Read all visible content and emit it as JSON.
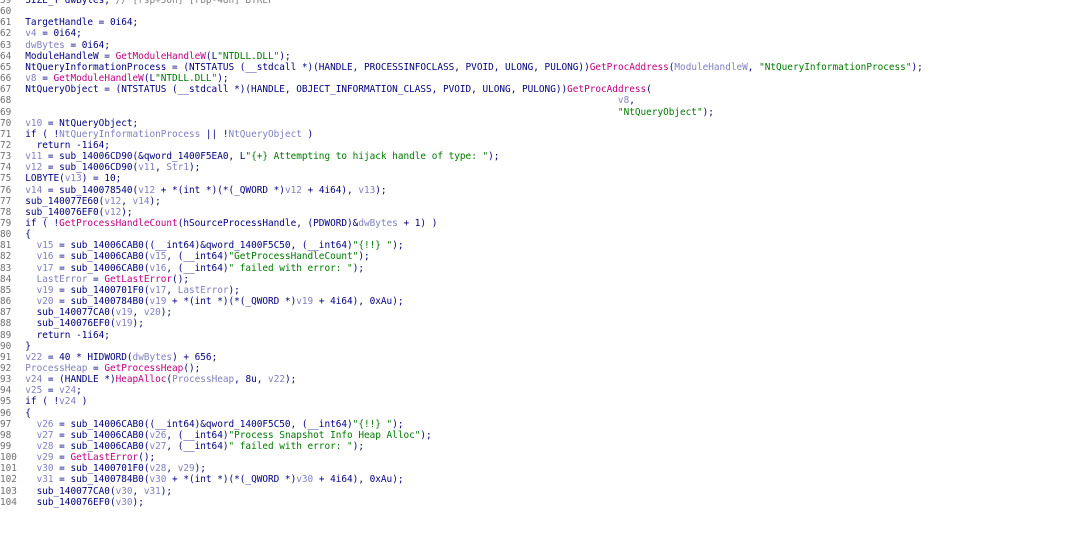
{
  "colors": {
    "background": "#ffffff",
    "default_text": "#000080",
    "function": "#c00080",
    "string": "#007a00",
    "comment": "#7f7f7f",
    "variable": "#8080c0",
    "line_number": "#707070"
  },
  "lines": [
    {
      "num": "59",
      "tokens": [
        [
          "k",
          "  SIZE_T dwBytes; "
        ],
        [
          "c",
          "// [rsp+50h] [rbp-48h] BYREF"
        ]
      ]
    },
    {
      "num": "60",
      "tokens": []
    },
    {
      "num": "61",
      "tokens": [
        [
          "k",
          "  TargetHandle = 0i64;"
        ]
      ]
    },
    {
      "num": "62",
      "tokens": [
        [
          "v",
          "  v4"
        ],
        [
          "k",
          " = 0i64;"
        ]
      ]
    },
    {
      "num": "63",
      "tokens": [
        [
          "v",
          "  dwBytes"
        ],
        [
          "k",
          " = 0i64;"
        ]
      ]
    },
    {
      "num": "64",
      "tokens": [
        [
          "k",
          "  ModuleHandleW = "
        ],
        [
          "f",
          "GetModuleHandleW"
        ],
        [
          "k",
          "(L"
        ],
        [
          "s",
          "\"NTDLL.DLL\""
        ],
        [
          "k",
          ");"
        ]
      ]
    },
    {
      "num": "65",
      "tokens": [
        [
          "k",
          "  NtQueryInformationProcess = (NTSTATUS (__stdcall *)(HANDLE, PROCESSINFOCLASS, PVOID, ULONG, PULONG))"
        ],
        [
          "f",
          "GetProcAddress"
        ],
        [
          "k",
          "("
        ],
        [
          "v",
          "ModuleHandleW"
        ],
        [
          "k",
          ", "
        ],
        [
          "s",
          "\"NtQueryInformationProcess\""
        ],
        [
          "k",
          ");"
        ]
      ]
    },
    {
      "num": "66",
      "tokens": [
        [
          "v",
          "  v8"
        ],
        [
          "k",
          " = "
        ],
        [
          "f",
          "GetModuleHandleW"
        ],
        [
          "k",
          "(L"
        ],
        [
          "s",
          "\"NTDLL.DLL\""
        ],
        [
          "k",
          ");"
        ]
      ]
    },
    {
      "num": "67",
      "tokens": [
        [
          "k",
          "  NtQueryObject = (NTSTATUS (__stdcall *)(HANDLE, OBJECT_INFORMATION_CLASS, PVOID, ULONG, PULONG))"
        ],
        [
          "f",
          "GetProcAddress"
        ],
        [
          "k",
          "("
        ]
      ]
    },
    {
      "num": "68",
      "tokens": [
        [
          "v",
          "                                                                                                           v8"
        ],
        [
          "k",
          ","
        ]
      ]
    },
    {
      "num": "69",
      "tokens": [
        [
          "s",
          "                                                                                                           \"NtQueryObject\""
        ],
        [
          "k",
          ");"
        ]
      ]
    },
    {
      "num": "70",
      "tokens": [
        [
          "v",
          "  v10"
        ],
        [
          "k",
          " = NtQueryObject;"
        ]
      ]
    },
    {
      "num": "71",
      "tokens": [
        [
          "k",
          "  if ( !"
        ],
        [
          "v",
          "NtQueryInformationProcess"
        ],
        [
          "k",
          " || !"
        ],
        [
          "v",
          "NtQueryObject"
        ],
        [
          "k",
          " )"
        ]
      ]
    },
    {
      "num": "72",
      "tokens": [
        [
          "k",
          "    return -1i64;"
        ]
      ]
    },
    {
      "num": "73",
      "tokens": [
        [
          "v",
          "  v11"
        ],
        [
          "k",
          " = sub_14006CD90(&qword_1400F5EA0, L"
        ],
        [
          "s",
          "\"{+} Attempting to hijack handle of type: \""
        ],
        [
          "k",
          ");"
        ]
      ]
    },
    {
      "num": "74",
      "tokens": [
        [
          "v",
          "  v12"
        ],
        [
          "k",
          " = sub_14006CD90("
        ],
        [
          "v",
          "v11"
        ],
        [
          "k",
          ", "
        ],
        [
          "v",
          "Str1"
        ],
        [
          "k",
          ");"
        ]
      ]
    },
    {
      "num": "75",
      "tokens": [
        [
          "k",
          "  LOBYTE("
        ],
        [
          "v",
          "v13"
        ],
        [
          "k",
          ") = 10;"
        ]
      ]
    },
    {
      "num": "76",
      "tokens": [
        [
          "v",
          "  v14"
        ],
        [
          "k",
          " = sub_140078540("
        ],
        [
          "v",
          "v12"
        ],
        [
          "k",
          " + *(int *)(*(_QWORD *)"
        ],
        [
          "v",
          "v12"
        ],
        [
          "k",
          " + 4i64), "
        ],
        [
          "v",
          "v13"
        ],
        [
          "k",
          ");"
        ]
      ]
    },
    {
      "num": "77",
      "tokens": [
        [
          "k",
          "  sub_140077E60("
        ],
        [
          "v",
          "v12"
        ],
        [
          "k",
          ", "
        ],
        [
          "v",
          "v14"
        ],
        [
          "k",
          ");"
        ]
      ]
    },
    {
      "num": "78",
      "tokens": [
        [
          "k",
          "  sub_140076EF0("
        ],
        [
          "v",
          "v12"
        ],
        [
          "k",
          ");"
        ]
      ]
    },
    {
      "num": "79",
      "tokens": [
        [
          "k",
          "  if ( !"
        ],
        [
          "f",
          "GetProcessHandleCount"
        ],
        [
          "k",
          "(hSourceProcessHandle, (PDWORD)&"
        ],
        [
          "v",
          "dwBytes"
        ],
        [
          "k",
          " + 1) )"
        ]
      ]
    },
    {
      "num": "80",
      "tokens": [
        [
          "k",
          "  {"
        ]
      ]
    },
    {
      "num": "81",
      "tokens": [
        [
          "v",
          "    v15"
        ],
        [
          "k",
          " = sub_14006CAB0((__int64)&qword_1400F5C50, (__int64)"
        ],
        [
          "s",
          "\"{!!} \""
        ],
        [
          "k",
          ");"
        ]
      ]
    },
    {
      "num": "82",
      "tokens": [
        [
          "v",
          "    v16"
        ],
        [
          "k",
          " = sub_14006CAB0("
        ],
        [
          "v",
          "v15"
        ],
        [
          "k",
          ", (__int64)"
        ],
        [
          "s",
          "\"GetProcessHandleCount\""
        ],
        [
          "k",
          ");"
        ]
      ]
    },
    {
      "num": "83",
      "tokens": [
        [
          "v",
          "    v17"
        ],
        [
          "k",
          " = sub_14006CAB0("
        ],
        [
          "v",
          "v16"
        ],
        [
          "k",
          ", (__int64)"
        ],
        [
          "s",
          "\" failed with error: \""
        ],
        [
          "k",
          ");"
        ]
      ]
    },
    {
      "num": "84",
      "tokens": [
        [
          "v",
          "    LastError"
        ],
        [
          "k",
          " = "
        ],
        [
          "f",
          "GetLastError"
        ],
        [
          "k",
          "();"
        ]
      ]
    },
    {
      "num": "85",
      "tokens": [
        [
          "v",
          "    v19"
        ],
        [
          "k",
          " = sub_1400701F0("
        ],
        [
          "v",
          "v17"
        ],
        [
          "k",
          ", "
        ],
        [
          "v",
          "LastError"
        ],
        [
          "k",
          ");"
        ]
      ]
    },
    {
      "num": "86",
      "tokens": [
        [
          "v",
          "    v20"
        ],
        [
          "k",
          " = sub_1400784B0("
        ],
        [
          "v",
          "v19"
        ],
        [
          "k",
          " + *(int *)(*(_QWORD *)"
        ],
        [
          "v",
          "v19"
        ],
        [
          "k",
          " + 4i64), 0xAu);"
        ]
      ]
    },
    {
      "num": "87",
      "tokens": [
        [
          "k",
          "    sub_140077CA0("
        ],
        [
          "v",
          "v19"
        ],
        [
          "k",
          ", "
        ],
        [
          "v",
          "v20"
        ],
        [
          "k",
          ");"
        ]
      ]
    },
    {
      "num": "88",
      "tokens": [
        [
          "k",
          "    sub_140076EF0("
        ],
        [
          "v",
          "v19"
        ],
        [
          "k",
          ");"
        ]
      ]
    },
    {
      "num": "89",
      "tokens": [
        [
          "k",
          "    return -1i64;"
        ]
      ]
    },
    {
      "num": "90",
      "tokens": [
        [
          "k",
          "  }"
        ]
      ]
    },
    {
      "num": "91",
      "tokens": [
        [
          "v",
          "  v22"
        ],
        [
          "k",
          " = 40 * HIDWORD("
        ],
        [
          "v",
          "dwBytes"
        ],
        [
          "k",
          ") + 656;"
        ]
      ]
    },
    {
      "num": "92",
      "tokens": [
        [
          "v",
          "  ProcessHeap"
        ],
        [
          "k",
          " = "
        ],
        [
          "f",
          "GetProcessHeap"
        ],
        [
          "k",
          "();"
        ]
      ]
    },
    {
      "num": "93",
      "tokens": [
        [
          "v",
          "  v24"
        ],
        [
          "k",
          " = (HANDLE *)"
        ],
        [
          "f",
          "HeapAlloc"
        ],
        [
          "k",
          "("
        ],
        [
          "v",
          "ProcessHeap"
        ],
        [
          "k",
          ", 8u, "
        ],
        [
          "v",
          "v22"
        ],
        [
          "k",
          ");"
        ]
      ]
    },
    {
      "num": "94",
      "tokens": [
        [
          "v",
          "  v25"
        ],
        [
          "k",
          " = "
        ],
        [
          "v",
          "v24"
        ],
        [
          "k",
          ";"
        ]
      ]
    },
    {
      "num": "95",
      "tokens": [
        [
          "k",
          "  if ( !"
        ],
        [
          "v",
          "v24"
        ],
        [
          "k",
          " )"
        ]
      ]
    },
    {
      "num": "96",
      "tokens": [
        [
          "k",
          "  {"
        ]
      ]
    },
    {
      "num": "97",
      "tokens": [
        [
          "v",
          "    v26"
        ],
        [
          "k",
          " = sub_14006CAB0((__int64)&qword_1400F5C50, (__int64)"
        ],
        [
          "s",
          "\"{!!} \""
        ],
        [
          "k",
          ");"
        ]
      ]
    },
    {
      "num": "98",
      "tokens": [
        [
          "v",
          "    v27"
        ],
        [
          "k",
          " = sub_14006CAB0("
        ],
        [
          "v",
          "v26"
        ],
        [
          "k",
          ", (__int64)"
        ],
        [
          "s",
          "\"Process Snapshot Info Heap Alloc\""
        ],
        [
          "k",
          ");"
        ]
      ]
    },
    {
      "num": "99",
      "tokens": [
        [
          "v",
          "    v28"
        ],
        [
          "k",
          " = sub_14006CAB0("
        ],
        [
          "v",
          "v27"
        ],
        [
          "k",
          ", (__int64)"
        ],
        [
          "s",
          "\" failed with error: \""
        ],
        [
          "k",
          ");"
        ]
      ]
    },
    {
      "num": "100",
      "tokens": [
        [
          "v",
          "    v29"
        ],
        [
          "k",
          " = "
        ],
        [
          "f",
          "GetLastError"
        ],
        [
          "k",
          "();"
        ]
      ]
    },
    {
      "num": "101",
      "tokens": [
        [
          "v",
          "    v30"
        ],
        [
          "k",
          " = sub_1400701F0("
        ],
        [
          "v",
          "v28"
        ],
        [
          "k",
          ", "
        ],
        [
          "v",
          "v29"
        ],
        [
          "k",
          ");"
        ]
      ]
    },
    {
      "num": "102",
      "tokens": [
        [
          "v",
          "    v31"
        ],
        [
          "k",
          " = sub_1400784B0("
        ],
        [
          "v",
          "v30"
        ],
        [
          "k",
          " + *(int *)(*(_QWORD *)"
        ],
        [
          "v",
          "v30"
        ],
        [
          "k",
          " + 4i64), 0xAu);"
        ]
      ]
    },
    {
      "num": "103",
      "tokens": [
        [
          "k",
          "    sub_140077CA0("
        ],
        [
          "v",
          "v30"
        ],
        [
          "k",
          ", "
        ],
        [
          "v",
          "v31"
        ],
        [
          "k",
          ");"
        ]
      ]
    },
    {
      "num": "104",
      "tokens": [
        [
          "k",
          "    sub_140076EF0("
        ],
        [
          "v",
          "v30"
        ],
        [
          "k",
          ");"
        ]
      ]
    }
  ]
}
